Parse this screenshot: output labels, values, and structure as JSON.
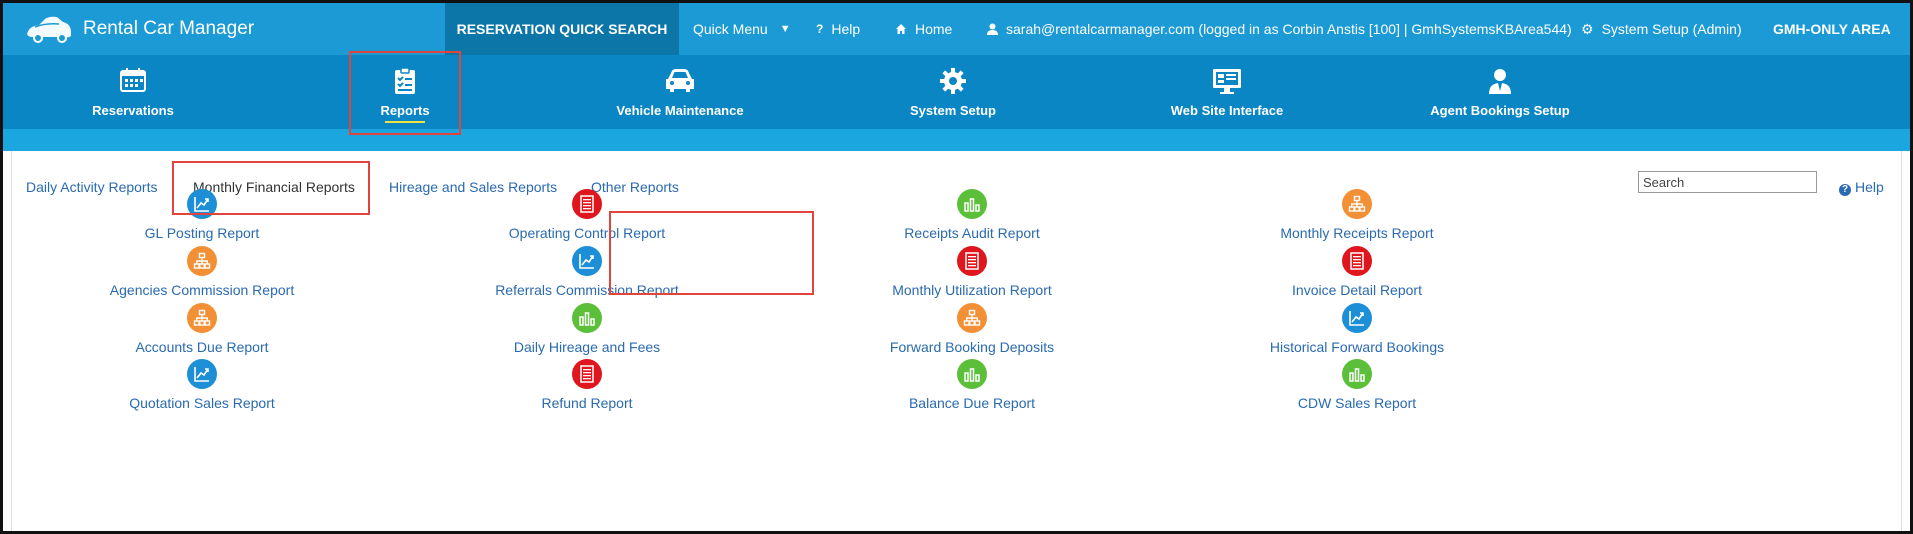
{
  "app": {
    "title": "Rental Car Manager"
  },
  "topbar": {
    "quick_search": "RESERVATION QUICK SEARCH",
    "quick_menu": "Quick Menu",
    "help": "Help",
    "home": "Home",
    "user": "sarah@rentalcarmanager.com (logged in as Corbin Anstis [100] | GmhSystemsKBArea544)",
    "system_setup": "System Setup (Admin)",
    "area": "GMH-ONLY AREA"
  },
  "main_nav": [
    {
      "label": "Reservations",
      "icon": "calendar-icon"
    },
    {
      "label": "Reports",
      "icon": "clipboard-checklist-icon"
    },
    {
      "label": "Vehicle Maintenance",
      "icon": "car-icon"
    },
    {
      "label": "System Setup",
      "icon": "gear-icon"
    },
    {
      "label": "Web Site Interface",
      "icon": "monitor-icon"
    },
    {
      "label": "Agent Bookings Setup",
      "icon": "agent-icon"
    }
  ],
  "tabs": [
    {
      "label": "Daily Activity Reports"
    },
    {
      "label": "Monthly Financial Reports",
      "active": true
    },
    {
      "label": "Hireage and Sales Reports"
    },
    {
      "label": "Other Reports"
    }
  ],
  "search": {
    "placeholder": "Search"
  },
  "help_link": "Help",
  "colors": {
    "blue": "#1c8fd6",
    "orange": "#f39035",
    "red": "#e0161e",
    "green": "#5cbf3a"
  },
  "reports": [
    {
      "label": "GL Posting Report",
      "icon": "chart-icon",
      "color": "blue"
    },
    {
      "label": "Operating Control Report",
      "icon": "document-icon",
      "color": "red"
    },
    {
      "label": "Receipts Audit Report",
      "icon": "bar-chart-icon",
      "color": "green"
    },
    {
      "label": "Monthly Receipts Report",
      "icon": "hierarchy-icon",
      "color": "orange"
    },
    {
      "label": "Agencies Commission Report",
      "icon": "hierarchy-icon",
      "color": "orange"
    },
    {
      "label": "Referrals Commission Report",
      "icon": "chart-icon",
      "color": "blue"
    },
    {
      "label": "Monthly Utilization Report",
      "icon": "document-icon",
      "color": "red"
    },
    {
      "label": "Invoice Detail Report",
      "icon": "document-icon",
      "color": "red"
    },
    {
      "label": "Accounts Due Report",
      "icon": "hierarchy-icon",
      "color": "orange"
    },
    {
      "label": "Daily Hireage and Fees",
      "icon": "bar-chart-icon",
      "color": "green"
    },
    {
      "label": "Forward Booking Deposits",
      "icon": "hierarchy-icon",
      "color": "orange"
    },
    {
      "label": "Historical Forward Bookings",
      "icon": "chart-icon",
      "color": "blue"
    },
    {
      "label": "Quotation Sales Report",
      "icon": "chart-icon",
      "color": "blue"
    },
    {
      "label": "Refund Report",
      "icon": "document-icon",
      "color": "red"
    },
    {
      "label": "Balance Due Report",
      "icon": "bar-chart-icon",
      "color": "green"
    },
    {
      "label": "CDW Sales Report",
      "icon": "bar-chart-icon",
      "color": "green"
    }
  ]
}
